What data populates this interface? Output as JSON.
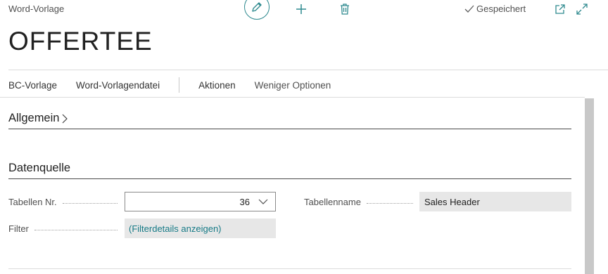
{
  "header": {
    "page_type": "Word-Vorlage",
    "saved_status": "Gespeichert",
    "title": "OFFERTEE"
  },
  "actions": {
    "bc_vorlage": "BC-Vorlage",
    "word_vorlagendatei": "Word-Vorlagendatei",
    "aktionen": "Aktionen",
    "weniger_optionen": "Weniger Optionen"
  },
  "sections": {
    "allgemein": "Allgemein",
    "datenquelle": "Datenquelle"
  },
  "fields": {
    "tabellen_nr_label": "Tabellen Nr.",
    "tabellen_nr_value": "36",
    "tabellenname_label": "Tabellenname",
    "tabellenname_value": "Sales Header",
    "filter_label": "Filter",
    "filter_value": "(Filterdetails anzeigen)"
  },
  "colors": {
    "accent": "#2f8a8f",
    "link": "#167a86",
    "readonly_bg": "#e7e7e7"
  },
  "icons": [
    "pencil-icon",
    "plus-icon",
    "trash-icon",
    "checkmark-icon",
    "open-new-window-icon",
    "expand-icon",
    "chevron-right-icon",
    "chevron-down-icon"
  ]
}
